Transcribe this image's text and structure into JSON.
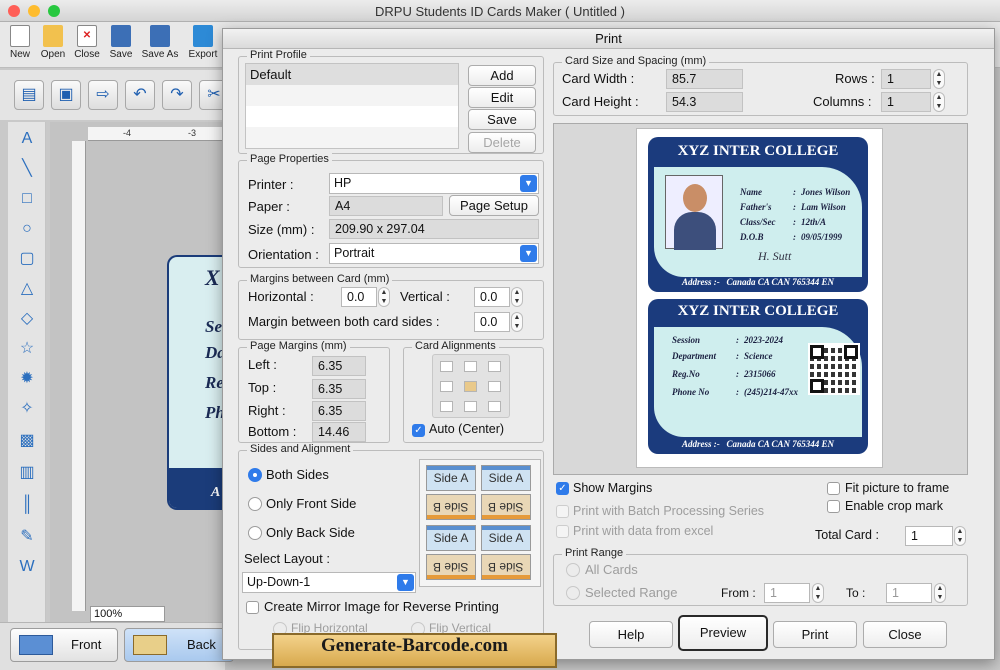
{
  "app": {
    "title": "DRPU Students ID Cards Maker ( Untitled )"
  },
  "toolbar": {
    "items": [
      "New",
      "Open",
      "Close",
      "Save",
      "Save As",
      "Export"
    ]
  },
  "canvas": {
    "zoom": "100%",
    "ruler_ticks": [
      "-4",
      "-3"
    ],
    "card_letters": [
      "X",
      "Se",
      "Da",
      "Re",
      "Ph",
      "A"
    ]
  },
  "bottom": {
    "front_label": "Front",
    "back_label": "Back"
  },
  "dialog": {
    "title": "Print",
    "print_profile": {
      "legend": "Print Profile",
      "items": [
        "Default"
      ],
      "add": "Add",
      "edit": "Edit",
      "save": "Save",
      "delete": "Delete"
    },
    "page_properties": {
      "legend": "Page Properties",
      "printer_label": "Printer :",
      "printer": "HP",
      "paper_label": "Paper :",
      "paper": "A4",
      "page_setup": "Page Setup",
      "size_label": "Size (mm) :",
      "size": "209.90 x 297.04",
      "orientation_label": "Orientation :",
      "orientation": "Portrait"
    },
    "margins_between": {
      "legend": "Margins between Card (mm)",
      "horizontal_label": "Horizontal :",
      "horizontal": "0.0",
      "vertical_label": "Vertical :",
      "vertical": "0.0",
      "both_sides_label": "Margin between both card sides :",
      "both_sides": "0.0"
    },
    "page_margins": {
      "legend": "Page Margins (mm)",
      "left_label": "Left :",
      "left": "6.35",
      "top_label": "Top :",
      "top": "6.35",
      "right_label": "Right :",
      "right": "6.35",
      "bottom_label": "Bottom :",
      "bottom": "14.46"
    },
    "card_alignments": {
      "legend": "Card Alignments",
      "auto_center": "Auto (Center)"
    },
    "sides": {
      "legend": "Sides and Alignment",
      "both": "Both Sides",
      "front_only": "Only Front Side",
      "back_only": "Only Back Side",
      "select_layout": "Select Layout :",
      "layout": "Up-Down-1",
      "side_a": "Side A",
      "side_b": "Side B",
      "mirror": "Create Mirror Image for Reverse Printing",
      "flip_h": "Flip Horizontal",
      "flip_v": "Flip Vertical"
    },
    "card_size": {
      "legend": "Card Size and Spacing (mm)",
      "width_label": "Card Width :",
      "width": "85.7",
      "height_label": "Card Height :",
      "height": "54.3",
      "rows_label": "Rows :",
      "rows": "1",
      "columns_label": "Columns :",
      "columns": "1"
    },
    "preview_card_front": {
      "college": "XYZ INTER COLLEGE",
      "rows": [
        [
          "Name",
          ":",
          "Jones Wilson"
        ],
        [
          "Father's",
          ":",
          "Lam Wilson"
        ],
        [
          "Class/Sec",
          ":",
          "12th/A"
        ],
        [
          "D.O.B",
          ":",
          "09/05/1999"
        ]
      ],
      "signature": "H. Sutt",
      "address_label": "Address :-",
      "address": "Canada CA CAN 765344 EN"
    },
    "preview_card_back": {
      "college": "XYZ INTER COLLEGE",
      "rows": [
        [
          "Session",
          ":",
          "2023-2024"
        ],
        [
          "Department",
          ":",
          "Science"
        ],
        [
          "Reg.No",
          ":",
          "2315066"
        ],
        [
          "Phone No",
          ":",
          "(245)214-47xx"
        ]
      ],
      "address_label": "Address :-",
      "address": "Canada CA CAN 765344 EN"
    },
    "options": {
      "show_margins": "Show Margins",
      "fit_picture": "Fit picture to frame",
      "crop_mark": "Enable crop mark",
      "batch": "Print with Batch Processing Series",
      "excel": "Print with data from excel",
      "total_card_label": "Total Card :",
      "total_card": "1"
    },
    "print_range": {
      "legend": "Print Range",
      "all": "All Cards",
      "selected": "Selected Range",
      "from_label": "From :",
      "from": "1",
      "to_label": "To :",
      "to": "1"
    },
    "buttons": {
      "help": "Help",
      "preview": "Preview",
      "print": "Print",
      "close": "Close"
    }
  },
  "watermark": "Generate-Barcode.com",
  "colors": {
    "accent": "#2f7bea",
    "card_navy": "#1b3b7d",
    "card_light": "#cfeeee"
  }
}
